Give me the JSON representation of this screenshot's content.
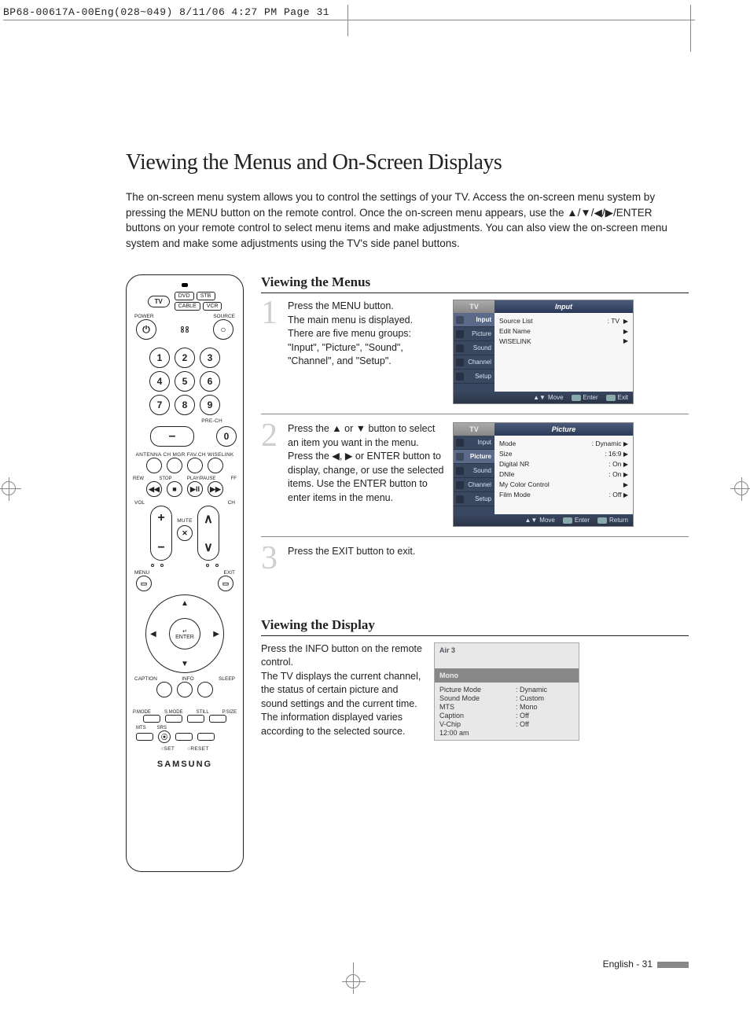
{
  "preheader": "BP68-00617A-00Eng(028~049)  8/11/06  4:27 PM  Page 31",
  "page_title": "Viewing the Menus and On-Screen Displays",
  "intro": "The on-screen menu system allows you to control the settings of your TV. Access the on-screen menu system by pressing the MENU button on the remote control. Once the on-screen menu appears, use the ▲/▼/◀/▶/ENTER buttons on your remote control to select menu items and make adjustments. You can also view the on-screen menu system and make some adjustments using the TV's side panel buttons.",
  "section_menus_title": "Viewing the Menus",
  "step1_num": "1",
  "step1_text": "Press the MENU button.\nThe main menu is displayed.\nThere are five menu groups: \"Input\", \"Picture\", \"Sound\", \"Channel\", and \"Setup\".",
  "step2_num": "2",
  "step2_text": "Press the ▲ or ▼ button to select an item you want in the menu.\nPress the ◀, ▶ or ENTER button to display, change, or use the selected items. Use the ENTER button to enter items in the menu.",
  "step3_num": "3",
  "step3_text": "Press the EXIT button to exit.",
  "section_display_title": "Viewing the Display",
  "display_text": "Press the INFO button on the remote control.\nThe TV displays the current channel, the status of certain picture and sound settings and the current time.\nThe information displayed varies according to the selected source.",
  "footer": "English - 31",
  "remote": {
    "tv": "TV",
    "dvd": "DVD",
    "stb": "STB",
    "cable": "CABLE",
    "vcr": "VCR",
    "power": "POWER",
    "source": "SOURCE",
    "nums": [
      "1",
      "2",
      "3",
      "4",
      "5",
      "6",
      "7",
      "8",
      "9",
      "0"
    ],
    "prech": "PRE-CH",
    "labels5": "ANTENNA CH MGR  FAV.CH  WISELINK",
    "rew": "REW",
    "stop": "STOP",
    "play": "PLAY/PAUSE",
    "ff": "FF",
    "vol": "VOL",
    "ch": "CH",
    "mute": "MUTE",
    "menu": "MENU",
    "exit": "EXIT",
    "enter": "ENTER",
    "caption": "CAPTION",
    "info": "INFO",
    "sleep": "SLEEP",
    "pmode": "P.MODE",
    "smode": "S.MODE",
    "still": "STILL",
    "psize": "P.SIZE",
    "mts": "MTS",
    "srs": "SRS",
    "set": "○SET",
    "reset": "○RESET",
    "brand": "SAMSUNG",
    "plus": "+",
    "minus": "−",
    "up": "∧",
    "down": "∨",
    "mute_glyph": "✕",
    "enter_glyph": "↵",
    "rew_g": "◀◀",
    "stop_g": "■",
    "play_g": "▶II",
    "ff_g": "▶▶",
    "dot_g": "⦿",
    "au": "▲",
    "ad": "▼",
    "al": "◀",
    "ar": "▶",
    "dash": "–",
    "pwg": "⏻",
    "srcg": "○"
  },
  "osd1": {
    "tv": "TV",
    "title": "Input",
    "tabs": [
      "Input",
      "Picture",
      "Sound",
      "Channel",
      "Setup"
    ],
    "rows": [
      {
        "l": "Source List",
        "v": ": TV"
      },
      {
        "l": "Edit Name",
        "v": ""
      },
      {
        "l": "WISELINK",
        "v": ""
      }
    ],
    "foot": {
      "move": "Move",
      "enter": "Enter",
      "exit": "Exit",
      "ud": "▲▼",
      "ei": "↵",
      "xi": "⊡"
    }
  },
  "osd2": {
    "tv": "TV",
    "title": "Picture",
    "tabs": [
      "Input",
      "Picture",
      "Sound",
      "Channel",
      "Setup"
    ],
    "rows": [
      {
        "l": "Mode",
        "v": ": Dynamic"
      },
      {
        "l": "Size",
        "v": ": 16:9"
      },
      {
        "l": "Digital NR",
        "v": ": On"
      },
      {
        "l": "DNIe",
        "v": ": On"
      },
      {
        "l": "My Color Control",
        "v": ""
      },
      {
        "l": "Film Mode",
        "v": ": Off"
      }
    ],
    "foot": {
      "move": "Move",
      "enter": "Enter",
      "ret": "Return",
      "ud": "▲▼",
      "ei": "↵",
      "ri": "⊡"
    }
  },
  "info": {
    "channel": "Air 3",
    "audio": "Mono",
    "rows": [
      [
        "Picture Mode",
        ": Dynamic"
      ],
      [
        "Sound Mode",
        ": Custom"
      ],
      [
        "MTS",
        ": Mono"
      ],
      [
        "Caption",
        ": Off"
      ],
      [
        "V-Chip",
        ": Off"
      ],
      [
        "12:00 am",
        ""
      ]
    ]
  }
}
